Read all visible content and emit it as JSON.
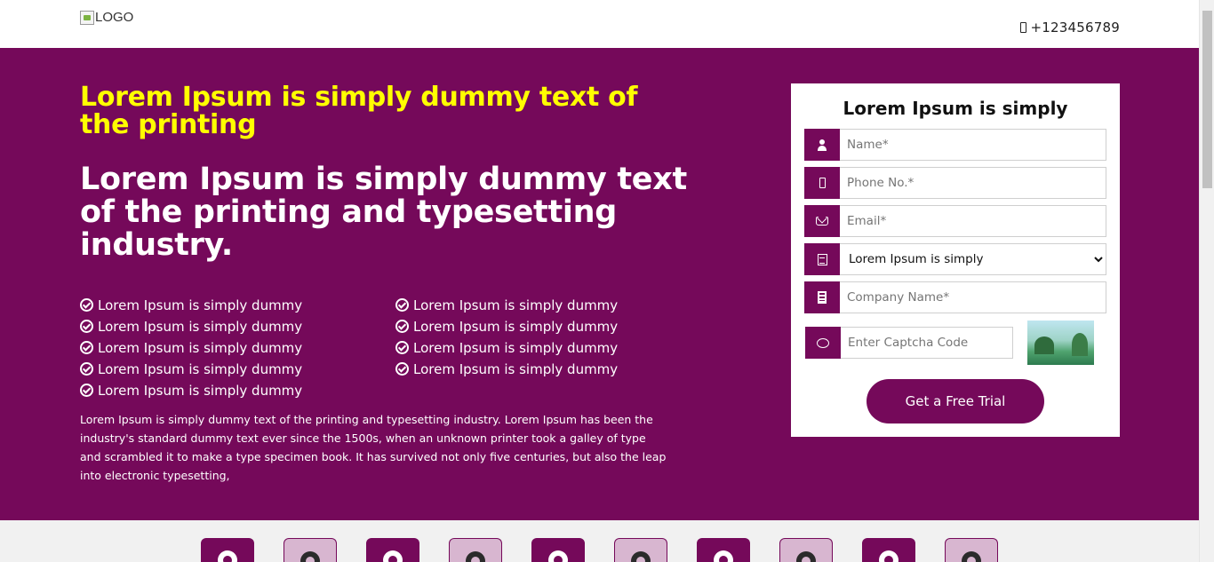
{
  "header": {
    "logo_alt": "LOGO",
    "phone": "+123456789"
  },
  "hero": {
    "kicker": "Lorem Ipsum is simply dummy text of the printing",
    "headline": "Lorem Ipsum is simply dummy text of the printing and typesetting industry.",
    "benefits": [
      "Lorem Ipsum is simply dummy",
      "Lorem Ipsum is simply dummy",
      "Lorem Ipsum is simply dummy",
      "Lorem Ipsum is simply dummy",
      "Lorem Ipsum is simply dummy",
      "Lorem Ipsum is simply dummy",
      "Lorem Ipsum is simply dummy",
      "Lorem Ipsum is simply dummy",
      "Lorem Ipsum is simply dummy"
    ],
    "paragraph": "Lorem Ipsum is simply dummy text of the printing and typesetting industry. Lorem Ipsum has been the industry's standard dummy text ever since the 1500s, when an unknown printer took a galley of type and scrambled it to make a type specimen book. It has survived not only five centuries, but also the leap into electronic typesetting,"
  },
  "form": {
    "title": "Lorem Ipsum is simply",
    "name_placeholder": "Name*",
    "phone_placeholder": "Phone No.*",
    "email_placeholder": "Email*",
    "select_value": "Lorem Ipsum is simply",
    "company_placeholder": "Company Name*",
    "captcha_placeholder": "Enter Captcha Code",
    "submit_label": "Get a Free Trial"
  },
  "colors": {
    "brand": "#75095a",
    "kicker": "#ffff00"
  },
  "icons": [
    "mobile-icon",
    "check-circle-icon",
    "user-icon",
    "mail-icon",
    "document-icon",
    "building-icon",
    "chat-icon",
    "gear-icon"
  ]
}
